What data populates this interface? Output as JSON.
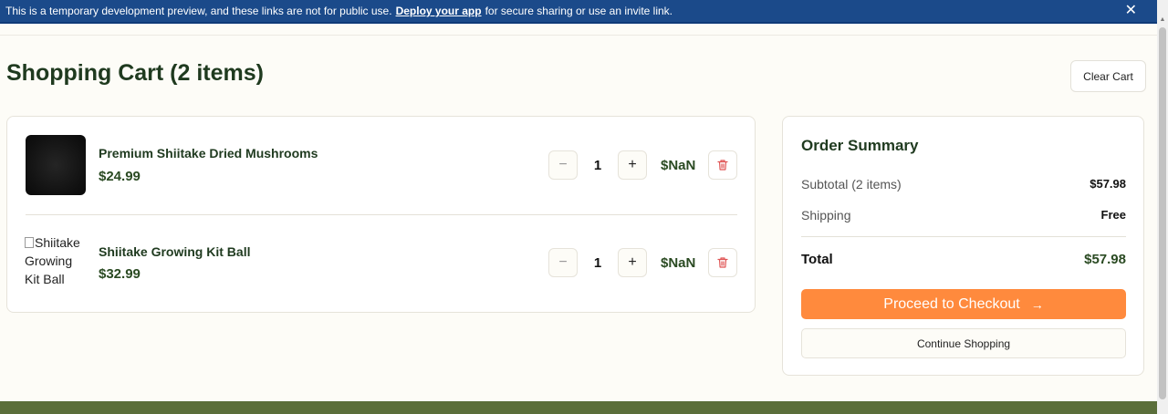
{
  "banner": {
    "text_before": "This is a temporary development preview, and these links are not for public use.",
    "link_text": "Deploy your app",
    "text_after": "for secure sharing or use an invite link.",
    "close_glyph": "✕"
  },
  "page": {
    "title": "Shopping Cart (2 items)",
    "clear_label": "Clear Cart"
  },
  "cart": {
    "items": [
      {
        "name": "Premium Shiitake Dried Mushrooms",
        "price": "$24.99",
        "quantity": "1",
        "line_total": "$NaN",
        "minus": "−",
        "plus": "+"
      },
      {
        "name": "Shiitake Growing Kit Ball",
        "price": "$32.99",
        "quantity": "1",
        "line_total": "$NaN",
        "minus": "−",
        "plus": "+",
        "image_alt": "Shiitake Growing Kit Ball"
      }
    ]
  },
  "summary": {
    "heading": "Order Summary",
    "subtotal_label": "Subtotal (2 items)",
    "subtotal_value": "$57.98",
    "shipping_label": "Shipping",
    "shipping_value": "Free",
    "total_label": "Total",
    "total_value": "$57.98",
    "checkout_label": "Proceed to Checkout",
    "checkout_arrow": "→",
    "continue_label": "Continue Shopping"
  },
  "colors": {
    "banner_bg": "#1b4a8a",
    "accent_orange": "#ff8a3d",
    "text_green": "#1f3a1f",
    "trash_red": "#e05555",
    "footer_green": "#5a6e3a"
  }
}
